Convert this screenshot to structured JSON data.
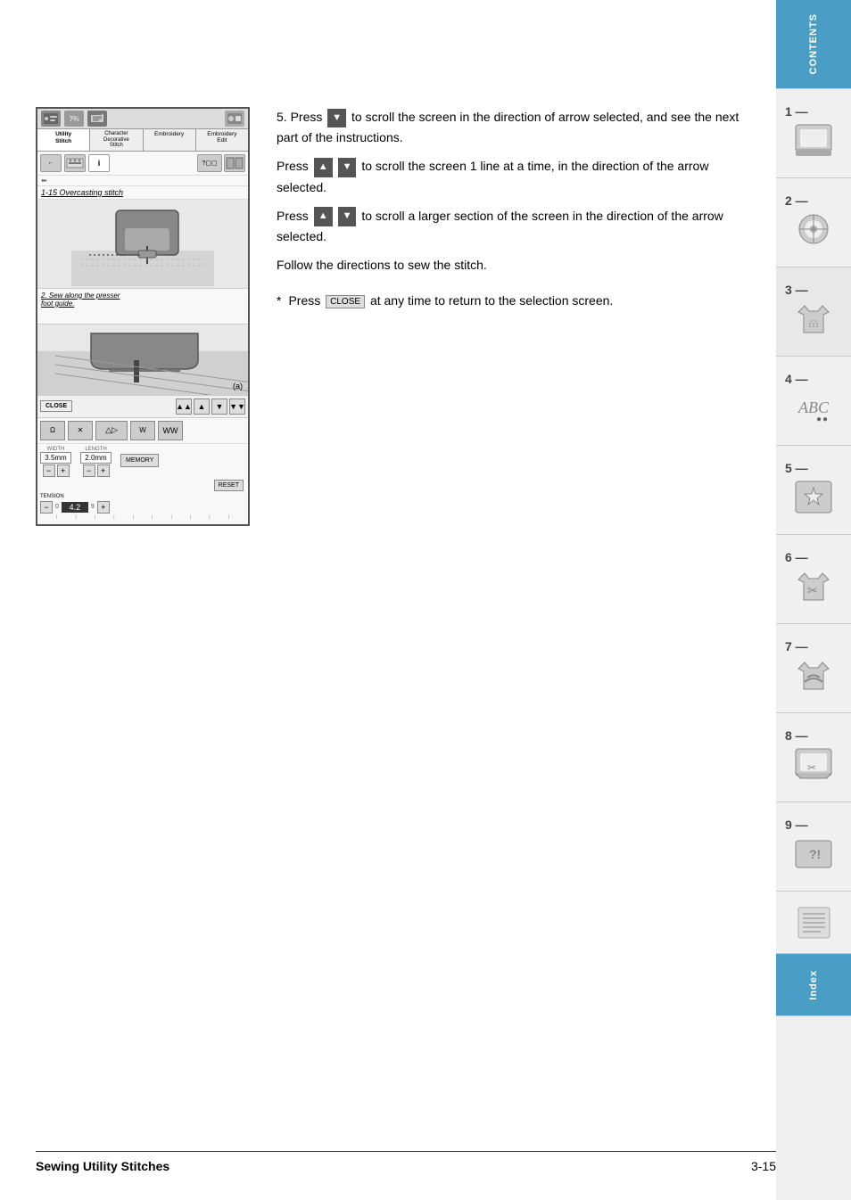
{
  "page": {
    "footer_title": "Sewing Utility Stitches",
    "footer_page": "3-15"
  },
  "sidebar": {
    "contents_label": "CONTENTS",
    "index_label": "Index",
    "tabs": [
      {
        "number": "1",
        "dash": "—"
      },
      {
        "number": "2",
        "dash": "—"
      },
      {
        "number": "3",
        "dash": "—"
      },
      {
        "number": "4",
        "dash": "—"
      },
      {
        "number": "5",
        "dash": "—"
      },
      {
        "number": "6",
        "dash": "—"
      },
      {
        "number": "7",
        "dash": "—"
      },
      {
        "number": "8",
        "dash": "—"
      },
      {
        "number": "9",
        "dash": "—"
      }
    ]
  },
  "machine_screen": {
    "tabs": [
      "Utility\nStitch",
      "Character\nDecorative\nStitch",
      "Embroidery",
      "Embroidery\nEdit"
    ],
    "stitch_title": "1-15 Overcasting stitch",
    "text_content": "2. Sew along the presser\nfoot guide.",
    "close_label": "CLOSE",
    "width_label": "WIDTH",
    "length_label": "LENGTH",
    "width_value": "3.5mm",
    "length_value": "2.0mm",
    "memory_label": "MEMORY",
    "reset_label": "RESET",
    "tension_label": "TENSION",
    "tension_value": "4.2"
  },
  "instructions": {
    "step5": {
      "number": "5.",
      "text1": " Press ",
      "arrow_down": "▼",
      "text2": " to scroll the screen in the direction of arrow selected, and see the next part of the instructions.",
      "text3": "Press ",
      "arrow_up2": "▲",
      "arrow_down2": "▼",
      "text4": " to scroll the screen 1 line at a time, in the direction of the arrow selected.",
      "text5": "Press ",
      "arrow_up3": "▲",
      "arrow_down3": "▼",
      "text6": " to scroll a larger section of the screen in the direction of the arrow selected.",
      "text7": "Follow the directions to sew the stitch."
    },
    "note": {
      "asterisk": "*",
      "text1": "Press ",
      "close_label": "CLOSE",
      "text2": " at any time to return to the selection screen."
    }
  }
}
